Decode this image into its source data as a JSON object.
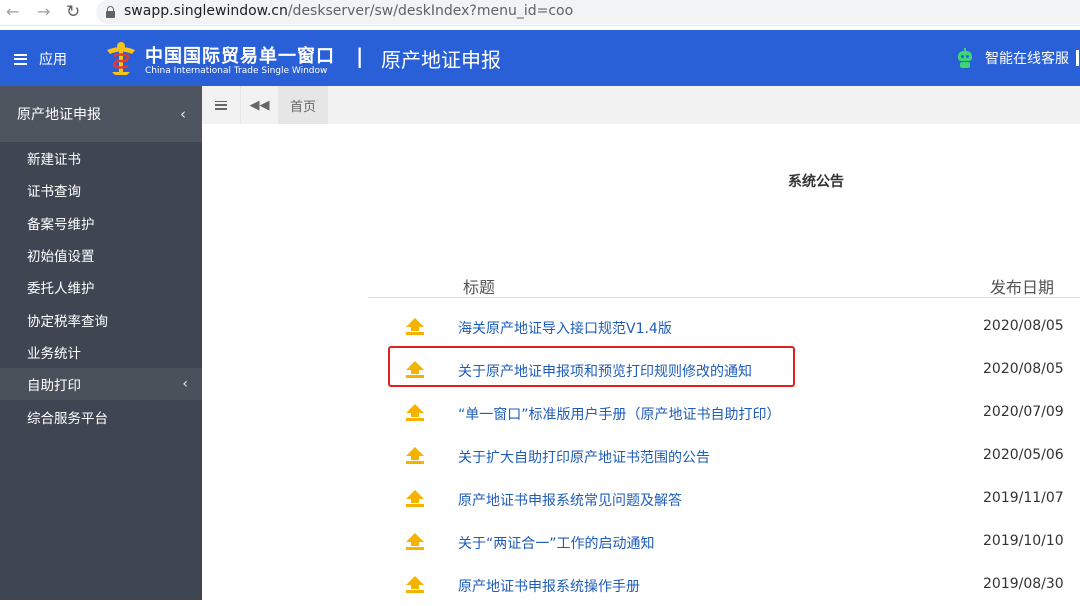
{
  "browser": {
    "url_host": "swapp.singlewindow.cn",
    "url_path": "/deskserver/sw/deskIndex?menu_id=coo"
  },
  "header": {
    "app_label": "应用",
    "brand_cn": "中国国际贸易单一窗口",
    "brand_en": "China International Trade Single Window",
    "separator": "|",
    "module_title": "原产地证申报",
    "service_label": "智能在线客服",
    "colors": {
      "bar": "#2960d8",
      "robot": "#3fd37a"
    }
  },
  "sidebar": {
    "section_title": "原产地证申报",
    "items": [
      {
        "label": "新建证书"
      },
      {
        "label": "证书查询"
      },
      {
        "label": "备案号维护"
      },
      {
        "label": "初始值设置"
      },
      {
        "label": "委托人维护"
      },
      {
        "label": "协定税率查询"
      },
      {
        "label": "业务统计"
      },
      {
        "label": "自助打印",
        "has_submenu": true
      },
      {
        "label": "综合服务平台"
      }
    ]
  },
  "tabs": {
    "home": "首页"
  },
  "notice": {
    "title": "系统公告",
    "col_title": "标题",
    "col_date": "发布日期",
    "rows": [
      {
        "title": "海关原产地证导入接口规范V1.4版",
        "date": "2020/08/05"
      },
      {
        "title": "关于原产地证申报项和预览打印规则修改的通知",
        "date": "2020/08/05",
        "highlighted": true
      },
      {
        "title": "“单一窗口”标准版用户手册（原产地证书自助打印）",
        "date": "2020/07/09"
      },
      {
        "title": "关于扩大自助打印原产地证书范围的公告",
        "date": "2020/05/06"
      },
      {
        "title": "原产地证书申报系统常见问题及解答",
        "date": "2019/11/07"
      },
      {
        "title": "关于“两证合一”工作的启动通知",
        "date": "2019/10/10"
      },
      {
        "title": "原产地证书申报系统操作手册",
        "date": "2019/08/30"
      }
    ]
  }
}
